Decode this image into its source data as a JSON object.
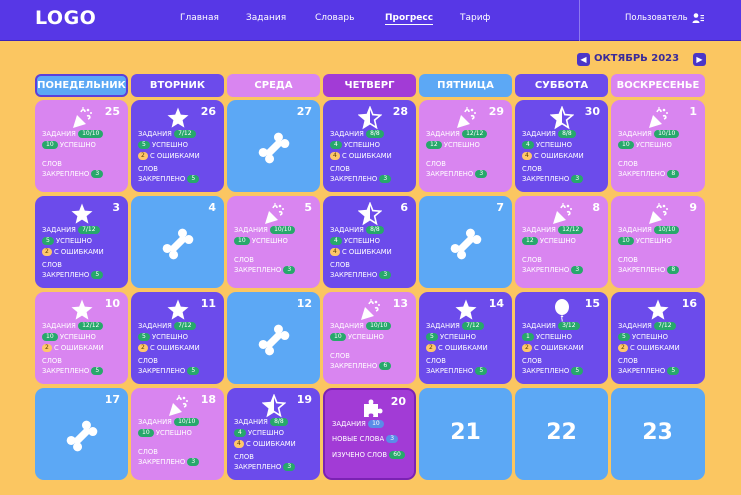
{
  "header": {
    "logo": "LOGO",
    "nav": [
      {
        "label": "Главная"
      },
      {
        "label": "Задания"
      },
      {
        "label": "Словарь"
      },
      {
        "label": "Прогресс"
      },
      {
        "label": "Тариф"
      }
    ],
    "user_label": "Пользователь"
  },
  "calendar": {
    "month_label": "ОКТЯБРЬ 2023",
    "weekdays": [
      "ПОНЕДЕЛЬНИК",
      "ВТОРНИК",
      "СРЕДА",
      "ЧЕТВЕРГ",
      "ПЯТНИЦА",
      "СУББОТА",
      "ВОСКРЕСЕНЬЕ"
    ],
    "labels": {
      "tasks": "ЗАДАНИЯ",
      "success": "УСПЕШНО",
      "errors": "С ОШИБКАМИ",
      "words": "СЛОВ",
      "fixed": "ЗАКРЕПЛЕНО",
      "new_words": "НОВЫЕ СЛОВА",
      "learned": "ИЗУЧЕНО СЛОВ"
    },
    "colors": {
      "purple": "#D985F0",
      "indigo": "#6C4BEB",
      "blue": "#5CA8F5",
      "violet": "#A23BD6",
      "success_badge": "#27A86B",
      "error_badge": "#FFC76A"
    },
    "days": [
      {
        "day": "25",
        "color": "purple",
        "icon": "party-popper-icon",
        "tasks": "10/10",
        "success": "10",
        "words": "3"
      },
      {
        "day": "26",
        "color": "indigo",
        "icon": "star-icon",
        "tasks": "7/12",
        "success": "5",
        "errors": "2",
        "words": "5"
      },
      {
        "day": "27",
        "color": "blue",
        "icon": "bone-icon"
      },
      {
        "day": "28",
        "color": "indigo",
        "icon": "half-star-icon",
        "tasks": "8/8",
        "success": "4",
        "errors": "4",
        "words": "3"
      },
      {
        "day": "29",
        "color": "purple",
        "icon": "party-popper-icon",
        "tasks": "12/12",
        "success": "12",
        "words": "3"
      },
      {
        "day": "30",
        "color": "indigo",
        "icon": "half-star-icon",
        "tasks": "8/8",
        "success": "4",
        "errors": "4",
        "words": "3"
      },
      {
        "day": "1",
        "color": "purple",
        "icon": "party-popper-icon",
        "tasks": "10/10",
        "success": "10",
        "words": "8"
      },
      {
        "day": "3",
        "color": "indigo",
        "icon": "star-icon",
        "tasks": "7/12",
        "success": "5",
        "errors": "2",
        "words": "5"
      },
      {
        "day": "4",
        "color": "blue",
        "icon": "bone-icon"
      },
      {
        "day": "5",
        "color": "purple",
        "icon": "party-popper-icon",
        "tasks": "10/10",
        "success": "10",
        "words": "3"
      },
      {
        "day": "6",
        "color": "indigo",
        "icon": "half-star-icon",
        "tasks": "8/8",
        "success": "4",
        "errors": "4",
        "words": "3"
      },
      {
        "day": "7",
        "color": "blue",
        "icon": "bone-icon"
      },
      {
        "day": "8",
        "color": "purple",
        "icon": "party-popper-icon",
        "tasks": "12/12",
        "success": "12",
        "words": "3"
      },
      {
        "day": "9",
        "color": "purple",
        "icon": "party-popper-icon",
        "tasks": "10/10",
        "success": "10",
        "words": "8"
      },
      {
        "day": "10",
        "color": "purple",
        "icon": "star-icon",
        "tasks": "12/12",
        "success": "10",
        "errors": "2",
        "words": "5"
      },
      {
        "day": "11",
        "color": "indigo",
        "icon": "star-icon",
        "tasks": "7/12",
        "success": "5",
        "errors": "2",
        "words": "5"
      },
      {
        "day": "12",
        "color": "blue",
        "icon": "bone-icon"
      },
      {
        "day": "13",
        "color": "purple",
        "icon": "party-popper-icon",
        "tasks": "10/10",
        "success": "10",
        "words": "6"
      },
      {
        "day": "14",
        "color": "indigo",
        "icon": "star-icon",
        "tasks": "7/12",
        "success": "5",
        "errors": "2",
        "words": "5"
      },
      {
        "day": "15",
        "color": "indigo",
        "icon": "balloon-icon",
        "tasks": "3/12",
        "success": "1",
        "errors": "2",
        "words": "5"
      },
      {
        "day": "16",
        "color": "indigo",
        "icon": "star-icon",
        "tasks": "7/12",
        "success": "5",
        "errors": "2",
        "words": "5"
      },
      {
        "day": "17",
        "color": "blue",
        "icon": "bone-icon"
      },
      {
        "day": "18",
        "color": "purple",
        "icon": "party-popper-icon",
        "tasks": "10/10",
        "success": "10",
        "words": "3"
      },
      {
        "day": "19",
        "color": "indigo",
        "icon": "half-star-icon",
        "tasks": "8/8",
        "success": "4",
        "errors": "4",
        "words": "3"
      },
      {
        "day": "20",
        "color": "violet",
        "icon": "puzzle-icon",
        "today": true,
        "tasks": "10",
        "new_words": "3",
        "learned": "60"
      },
      {
        "day": "21",
        "color": "blue",
        "future": true
      },
      {
        "day": "22",
        "color": "blue",
        "future": true
      },
      {
        "day": "23",
        "color": "blue",
        "future": true
      }
    ]
  }
}
